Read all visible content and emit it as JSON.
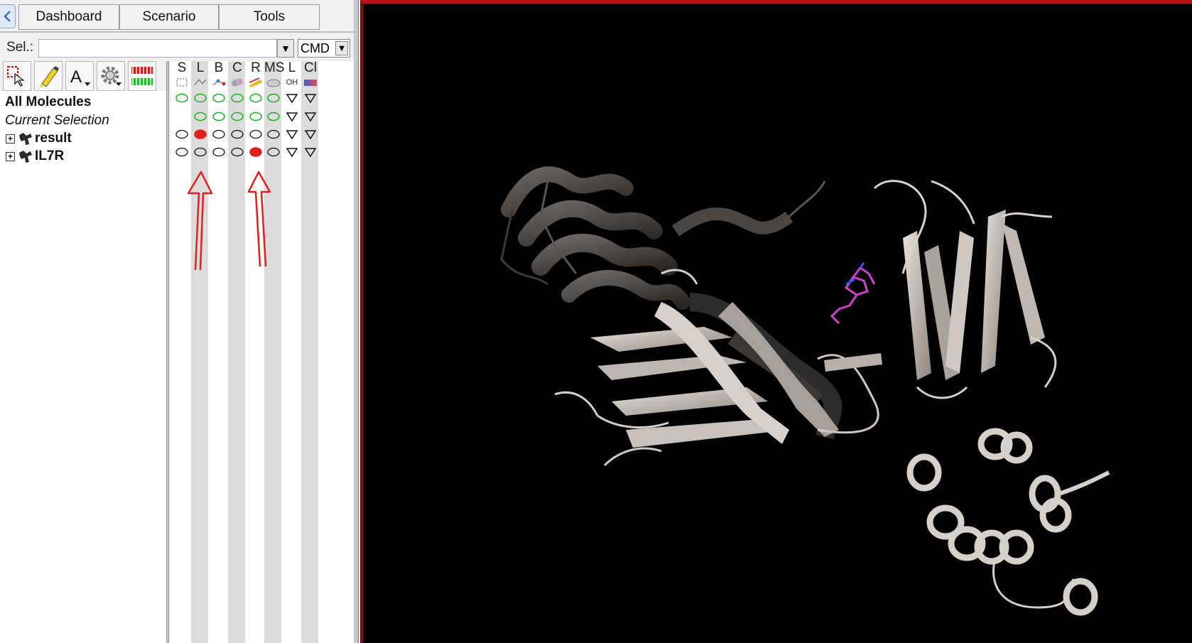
{
  "tabs": {
    "dashboard": "Dashboard",
    "scenario": "Scenario",
    "tools": "Tools"
  },
  "selection": {
    "label": "Sel.:",
    "value": "",
    "mode": "CMD"
  },
  "toolbar": {
    "icons": [
      "select-tool-icon",
      "highlight-pen-icon",
      "text-label-icon",
      "settings-gear-icon",
      "sequence-viewer-icon"
    ]
  },
  "tree": {
    "rows": [
      {
        "label": "All Molecules",
        "style": "bold"
      },
      {
        "label": "Current Selection",
        "style": "italic"
      },
      {
        "label": "result",
        "style": "bold",
        "expand": "+"
      },
      {
        "label": "IL7R",
        "style": "bold",
        "expand": "+"
      }
    ]
  },
  "columns": [
    {
      "key": "S",
      "label": "S",
      "sub": "selection-box-icon"
    },
    {
      "key": "L",
      "label": "L",
      "sub": "line-icon"
    },
    {
      "key": "B",
      "label": "B",
      "sub": "ball-stick-icon"
    },
    {
      "key": "C",
      "label": "C",
      "sub": "cpk-icon"
    },
    {
      "key": "R",
      "label": "R",
      "sub": "ribbon-icon"
    },
    {
      "key": "MS",
      "label": "MS",
      "sub": "molecular-surface-icon"
    },
    {
      "key": "L2",
      "label": "L",
      "sub_text": "OH"
    },
    {
      "key": "Cl",
      "label": "Cl",
      "sub": "color-gradient-icon"
    }
  ],
  "cell_states": [
    [
      "green",
      "green",
      "green",
      "green",
      "green",
      "green",
      "tri",
      "tri"
    ],
    [
      "none",
      "green",
      "green",
      "green",
      "green",
      "green",
      "tri",
      "tri"
    ],
    [
      "empty",
      "red",
      "empty",
      "empty",
      "empty",
      "empty",
      "tri",
      "tri"
    ],
    [
      "empty",
      "empty",
      "empty",
      "empty",
      "red",
      "empty",
      "tri",
      "tri"
    ]
  ],
  "colors": {
    "accent_red": "#e0201c",
    "on_green": "#1db31d",
    "viewport_border": "#b01818",
    "ligand": "#cc44cc"
  }
}
